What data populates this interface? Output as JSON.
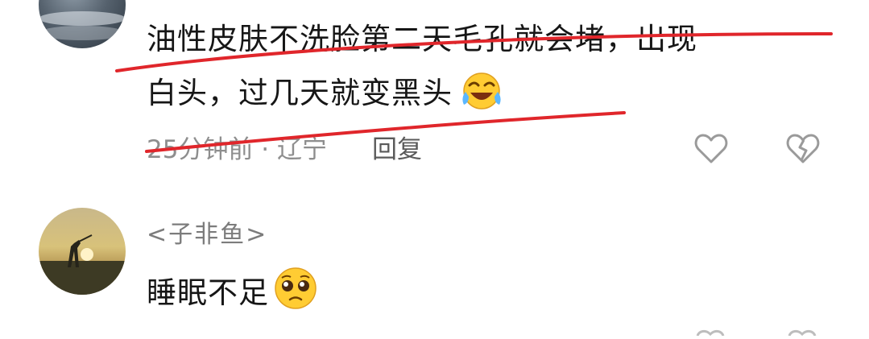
{
  "comments": [
    {
      "line1": "油性皮肤不洗脸第二天毛孔就会堵，出现",
      "line2": "白头，过几天就变黑头",
      "emoji": "laughing-crying-emoji",
      "time_location": "25分钟前 · 辽宁",
      "reply_label": "回复",
      "like_icon": "heart-outline-icon",
      "dislike_icon": "broken-heart-icon"
    },
    {
      "username": "<子非鱼>",
      "text": "睡眠不足",
      "emoji": "pleading-face-emoji"
    }
  ],
  "annotation_color": "#e0262b"
}
